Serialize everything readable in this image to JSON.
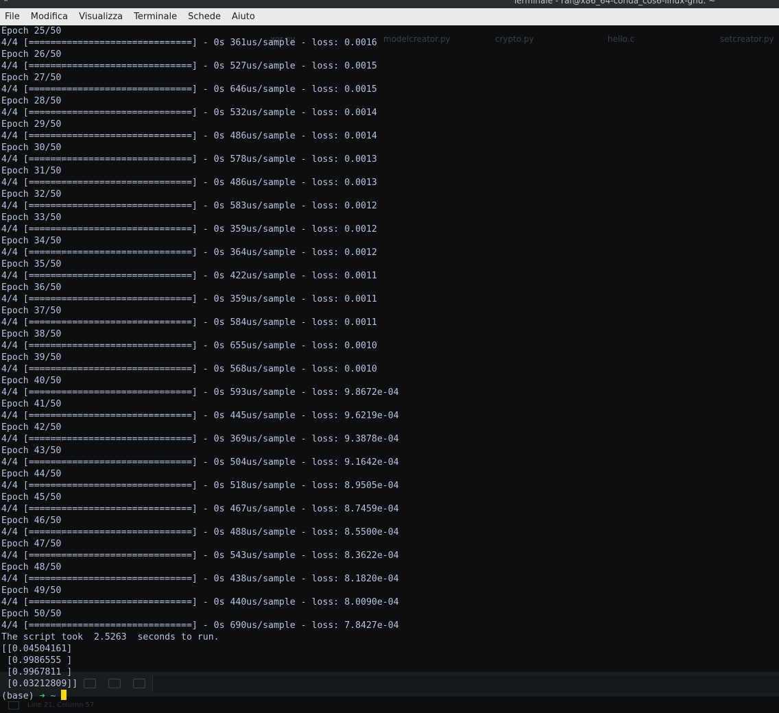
{
  "window": {
    "title": "Terminale - raf@x86_64-conda_cos6-linux-gnu: ~"
  },
  "menu": [
    "File",
    "Modifica",
    "Visualizza",
    "Terminale",
    "Schede",
    "Aiuto"
  ],
  "background_editor": {
    "tabs": [
      "xor.py",
      "modelcreator.py",
      "crypto.py",
      "hello.c",
      "setcreator.py"
    ],
    "status": "Line 21, Column 57"
  },
  "terminal": {
    "lines": [
      "Epoch 25/50",
      "4/4 [==============================] - 0s 361us/sample - loss: 0.0016",
      "Epoch 26/50",
      "4/4 [==============================] - 0s 527us/sample - loss: 0.0015",
      "Epoch 27/50",
      "4/4 [==============================] - 0s 646us/sample - loss: 0.0015",
      "Epoch 28/50",
      "4/4 [==============================] - 0s 532us/sample - loss: 0.0014",
      "Epoch 29/50",
      "4/4 [==============================] - 0s 486us/sample - loss: 0.0014",
      "Epoch 30/50",
      "4/4 [==============================] - 0s 578us/sample - loss: 0.0013",
      "Epoch 31/50",
      "4/4 [==============================] - 0s 486us/sample - loss: 0.0013",
      "Epoch 32/50",
      "4/4 [==============================] - 0s 583us/sample - loss: 0.0012",
      "Epoch 33/50",
      "4/4 [==============================] - 0s 359us/sample - loss: 0.0012",
      "Epoch 34/50",
      "4/4 [==============================] - 0s 364us/sample - loss: 0.0012",
      "Epoch 35/50",
      "4/4 [==============================] - 0s 422us/sample - loss: 0.0011",
      "Epoch 36/50",
      "4/4 [==============================] - 0s 359us/sample - loss: 0.0011",
      "Epoch 37/50",
      "4/4 [==============================] - 0s 584us/sample - loss: 0.0011",
      "Epoch 38/50",
      "4/4 [==============================] - 0s 655us/sample - loss: 0.0010",
      "Epoch 39/50",
      "4/4 [==============================] - 0s 568us/sample - loss: 0.0010",
      "Epoch 40/50",
      "4/4 [==============================] - 0s 593us/sample - loss: 9.8672e-04",
      "Epoch 41/50",
      "4/4 [==============================] - 0s 445us/sample - loss: 9.6219e-04",
      "Epoch 42/50",
      "4/4 [==============================] - 0s 369us/sample - loss: 9.3878e-04",
      "Epoch 43/50",
      "4/4 [==============================] - 0s 504us/sample - loss: 9.1642e-04",
      "Epoch 44/50",
      "4/4 [==============================] - 0s 518us/sample - loss: 8.9505e-04",
      "Epoch 45/50",
      "4/4 [==============================] - 0s 467us/sample - loss: 8.7459e-04",
      "Epoch 46/50",
      "4/4 [==============================] - 0s 488us/sample - loss: 8.5500e-04",
      "Epoch 47/50",
      "4/4 [==============================] - 0s 543us/sample - loss: 8.3622e-04",
      "Epoch 48/50",
      "4/4 [==============================] - 0s 438us/sample - loss: 8.1820e-04",
      "Epoch 49/50",
      "4/4 [==============================] - 0s 440us/sample - loss: 8.0090e-04",
      "Epoch 50/50",
      "4/4 [==============================] - 0s 690us/sample - loss: 7.8427e-04",
      "The script took  2.5263  seconds to run.",
      "[[0.04504161]",
      " [0.9986555 ]",
      " [0.9967811 ]",
      " [0.03212809]]"
    ],
    "prompt": {
      "env": "(base)",
      "arrow": "➜",
      "dir": "~"
    }
  },
  "colors": {
    "terminal_bg": "#0c0e0f",
    "terminal_fg": "#b6c3df",
    "prompt_arrow": "#36d06a",
    "prompt_dir": "#36c6d0",
    "cursor": "#f5d800",
    "menubar_bg": "#e9eaeb"
  }
}
